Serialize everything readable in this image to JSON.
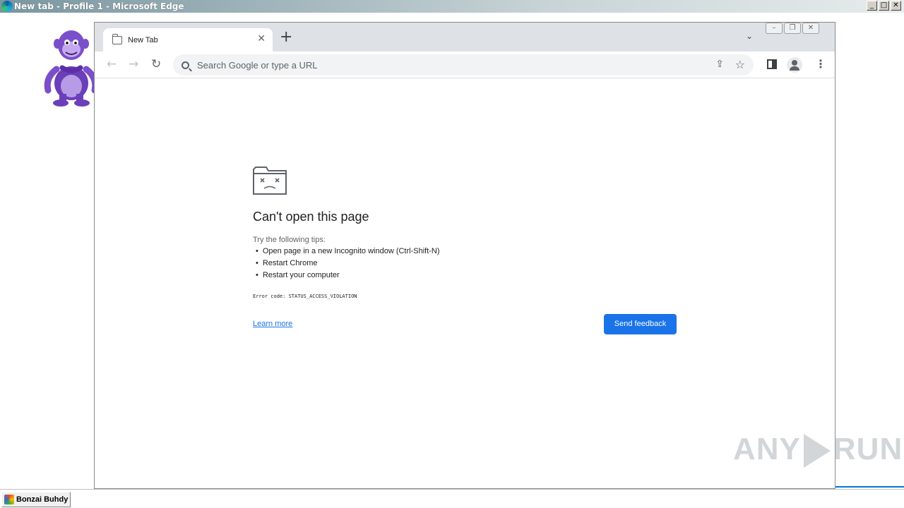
{
  "outer_window": {
    "title": "New tab - Profile 1 - Microsoft Edge",
    "controls": {
      "minimize": "_",
      "maximize": "□",
      "close": "✕"
    }
  },
  "browser": {
    "tab": {
      "title": "New Tab",
      "close_glyph": "✕"
    },
    "new_tab_glyph": "+",
    "tab_search_glyph": "⌄",
    "window_controls": {
      "minimize": "–",
      "restore": "❐",
      "close": "✕"
    },
    "nav": {
      "back": "←",
      "forward": "→",
      "reload": "↻"
    },
    "omnibox": {
      "placeholder": "Search Google or type a URL"
    },
    "toolbar_icons": {
      "share": "⇪",
      "bookmark": "☆",
      "menu": "⋮"
    }
  },
  "error_page": {
    "title": "Can't open this page",
    "tips_heading": "Try the following tips:",
    "tips": [
      "Open page in a new Incognito window (Ctrl-Shift-N)",
      "Restart Chrome",
      "Restart your computer"
    ],
    "error_code": "Error code: STATUS_ACCESS_VIOLATION",
    "learn_more": "Learn more",
    "send_feedback": "Send feedback"
  },
  "watermark": {
    "left": "ANY",
    "right": "RUN"
  },
  "taskbar": {
    "button_label": "Bonzai Buhdy"
  },
  "colors": {
    "accent": "#1a73e8",
    "tabstrip": "#dee1e6",
    "bonzi_purple": "#7b4fc9"
  }
}
